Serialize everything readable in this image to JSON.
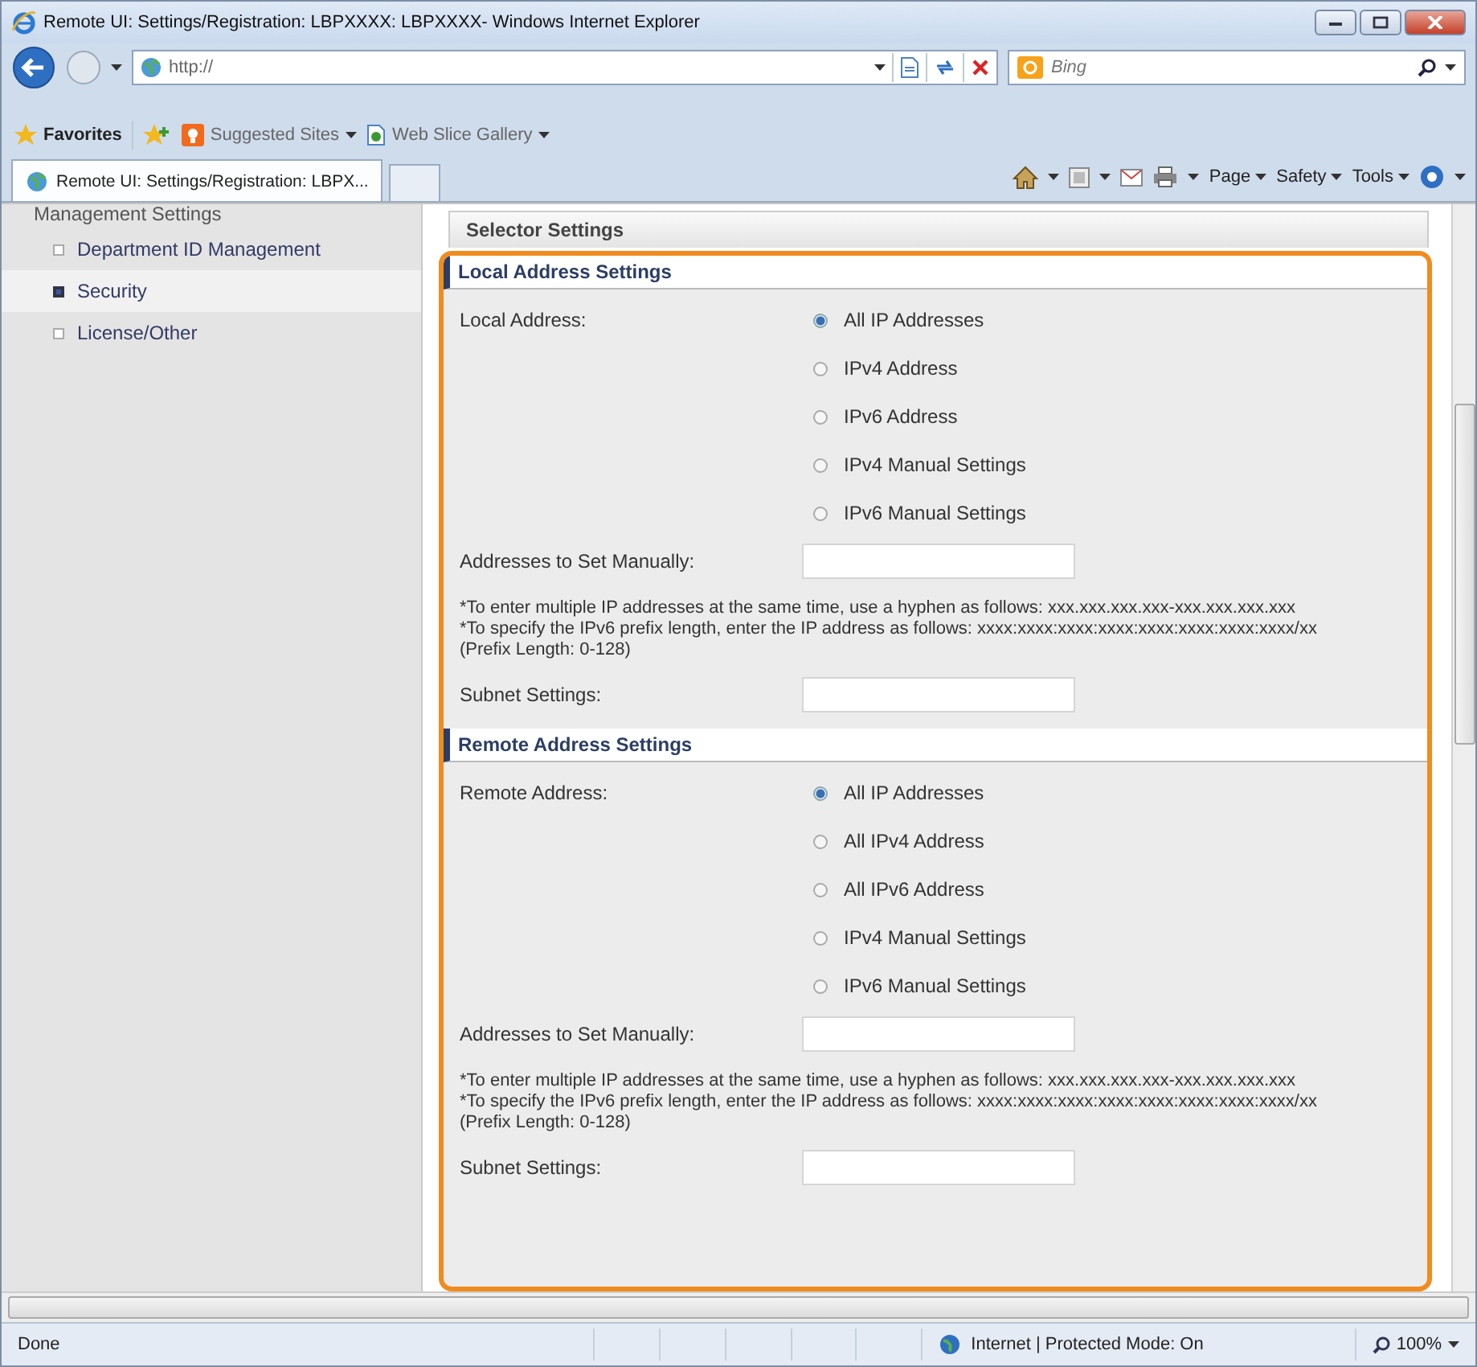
{
  "window": {
    "title": "Remote UI: Settings/Registration: LBPXXXX: LBPXXXX- Windows Internet Explorer"
  },
  "address_bar": {
    "url": "http://"
  },
  "search": {
    "placeholder": "Bing"
  },
  "favorites_bar": {
    "favorites": "Favorites",
    "links": [
      "Suggested Sites",
      "Web Slice Gallery"
    ]
  },
  "tabs": [
    {
      "label": "Remote UI: Settings/Registration: LBPX...",
      "selected": true
    }
  ],
  "command_bar": {
    "items": [
      "Page",
      "Safety",
      "Tools"
    ]
  },
  "sidebar": {
    "heading": "Management Settings",
    "items": [
      {
        "label": "Department ID Management",
        "selected": false
      },
      {
        "label": "Security",
        "selected": true
      },
      {
        "label": "License/Other",
        "selected": false
      }
    ]
  },
  "page": {
    "title": "Selector Settings",
    "sections": [
      {
        "title": "Local Address Settings",
        "rows": [
          {
            "kind": "radio",
            "label": "Local Address:",
            "options": [
              {
                "label": "All IP Addresses",
                "selected": true
              },
              {
                "label": "IPv4 Address",
                "selected": false
              },
              {
                "label": "IPv6 Address",
                "selected": false
              },
              {
                "label": "IPv4 Manual Settings",
                "selected": false
              },
              {
                "label": "IPv6 Manual Settings",
                "selected": false
              }
            ]
          },
          {
            "kind": "field",
            "label": "Addresses to Set Manually:"
          },
          {
            "kind": "note",
            "lines": [
              "*To enter multiple IP addresses at the same time, use a hyphen as follows: xxx.xxx.xxx.xxx-xxx.xxx.xxx.xxx",
              "*To specify the IPv6 prefix length, enter the IP address as follows: xxxx:xxxx:xxxx:xxxx:xxxx:xxxx:xxxx:xxxx/xx (Prefix Length: 0-128)"
            ]
          },
          {
            "kind": "field",
            "label": "Subnet Settings:"
          }
        ]
      },
      {
        "title": "Remote Address Settings",
        "rows": [
          {
            "kind": "radio",
            "label": "Remote Address:",
            "options": [
              {
                "label": "All IP Addresses",
                "selected": true
              },
              {
                "label": "All IPv4 Address",
                "selected": false
              },
              {
                "label": "All IPv6 Address",
                "selected": false
              },
              {
                "label": "IPv4 Manual Settings",
                "selected": false
              },
              {
                "label": "IPv6 Manual Settings",
                "selected": false
              }
            ]
          },
          {
            "kind": "field",
            "label": "Addresses to Set Manually:"
          },
          {
            "kind": "note",
            "lines": [
              "*To enter multiple IP addresses at the same time, use a hyphen as follows: xxx.xxx.xxx.xxx-xxx.xxx.xxx.xxx",
              "*To specify the IPv6 prefix length, enter the IP address as follows: xxxx:xxxx:xxxx:xxxx:xxxx:xxxx:xxxx:xxxx/xx (Prefix Length: 0-128)"
            ]
          },
          {
            "kind": "field",
            "label": "Subnet Settings:"
          }
        ]
      }
    ]
  },
  "status_bar": {
    "text": "Done",
    "zone": "Internet | Protected Mode: On",
    "zoom": "100%"
  }
}
